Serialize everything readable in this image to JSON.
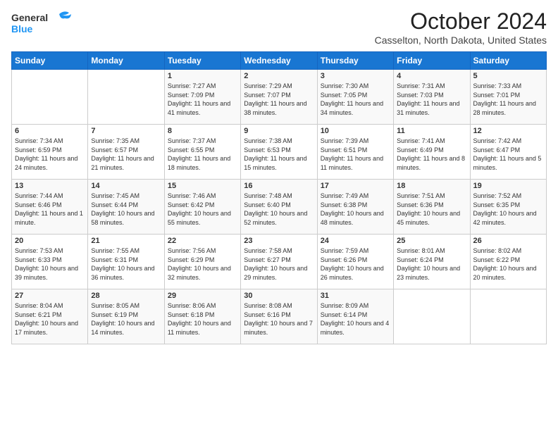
{
  "logo": {
    "line1": "General",
    "line2": "Blue"
  },
  "title": "October 2024",
  "location": "Casselton, North Dakota, United States",
  "days_of_week": [
    "Sunday",
    "Monday",
    "Tuesday",
    "Wednesday",
    "Thursday",
    "Friday",
    "Saturday"
  ],
  "weeks": [
    [
      {
        "day": "",
        "content": ""
      },
      {
        "day": "",
        "content": ""
      },
      {
        "day": "1",
        "content": "Sunrise: 7:27 AM\nSunset: 7:09 PM\nDaylight: 11 hours and 41 minutes."
      },
      {
        "day": "2",
        "content": "Sunrise: 7:29 AM\nSunset: 7:07 PM\nDaylight: 11 hours and 38 minutes."
      },
      {
        "day": "3",
        "content": "Sunrise: 7:30 AM\nSunset: 7:05 PM\nDaylight: 11 hours and 34 minutes."
      },
      {
        "day": "4",
        "content": "Sunrise: 7:31 AM\nSunset: 7:03 PM\nDaylight: 11 hours and 31 minutes."
      },
      {
        "day": "5",
        "content": "Sunrise: 7:33 AM\nSunset: 7:01 PM\nDaylight: 11 hours and 28 minutes."
      }
    ],
    [
      {
        "day": "6",
        "content": "Sunrise: 7:34 AM\nSunset: 6:59 PM\nDaylight: 11 hours and 24 minutes."
      },
      {
        "day": "7",
        "content": "Sunrise: 7:35 AM\nSunset: 6:57 PM\nDaylight: 11 hours and 21 minutes."
      },
      {
        "day": "8",
        "content": "Sunrise: 7:37 AM\nSunset: 6:55 PM\nDaylight: 11 hours and 18 minutes."
      },
      {
        "day": "9",
        "content": "Sunrise: 7:38 AM\nSunset: 6:53 PM\nDaylight: 11 hours and 15 minutes."
      },
      {
        "day": "10",
        "content": "Sunrise: 7:39 AM\nSunset: 6:51 PM\nDaylight: 11 hours and 11 minutes."
      },
      {
        "day": "11",
        "content": "Sunrise: 7:41 AM\nSunset: 6:49 PM\nDaylight: 11 hours and 8 minutes."
      },
      {
        "day": "12",
        "content": "Sunrise: 7:42 AM\nSunset: 6:47 PM\nDaylight: 11 hours and 5 minutes."
      }
    ],
    [
      {
        "day": "13",
        "content": "Sunrise: 7:44 AM\nSunset: 6:46 PM\nDaylight: 11 hours and 1 minute."
      },
      {
        "day": "14",
        "content": "Sunrise: 7:45 AM\nSunset: 6:44 PM\nDaylight: 10 hours and 58 minutes."
      },
      {
        "day": "15",
        "content": "Sunrise: 7:46 AM\nSunset: 6:42 PM\nDaylight: 10 hours and 55 minutes."
      },
      {
        "day": "16",
        "content": "Sunrise: 7:48 AM\nSunset: 6:40 PM\nDaylight: 10 hours and 52 minutes."
      },
      {
        "day": "17",
        "content": "Sunrise: 7:49 AM\nSunset: 6:38 PM\nDaylight: 10 hours and 48 minutes."
      },
      {
        "day": "18",
        "content": "Sunrise: 7:51 AM\nSunset: 6:36 PM\nDaylight: 10 hours and 45 minutes."
      },
      {
        "day": "19",
        "content": "Sunrise: 7:52 AM\nSunset: 6:35 PM\nDaylight: 10 hours and 42 minutes."
      }
    ],
    [
      {
        "day": "20",
        "content": "Sunrise: 7:53 AM\nSunset: 6:33 PM\nDaylight: 10 hours and 39 minutes."
      },
      {
        "day": "21",
        "content": "Sunrise: 7:55 AM\nSunset: 6:31 PM\nDaylight: 10 hours and 36 minutes."
      },
      {
        "day": "22",
        "content": "Sunrise: 7:56 AM\nSunset: 6:29 PM\nDaylight: 10 hours and 32 minutes."
      },
      {
        "day": "23",
        "content": "Sunrise: 7:58 AM\nSunset: 6:27 PM\nDaylight: 10 hours and 29 minutes."
      },
      {
        "day": "24",
        "content": "Sunrise: 7:59 AM\nSunset: 6:26 PM\nDaylight: 10 hours and 26 minutes."
      },
      {
        "day": "25",
        "content": "Sunrise: 8:01 AM\nSunset: 6:24 PM\nDaylight: 10 hours and 23 minutes."
      },
      {
        "day": "26",
        "content": "Sunrise: 8:02 AM\nSunset: 6:22 PM\nDaylight: 10 hours and 20 minutes."
      }
    ],
    [
      {
        "day": "27",
        "content": "Sunrise: 8:04 AM\nSunset: 6:21 PM\nDaylight: 10 hours and 17 minutes."
      },
      {
        "day": "28",
        "content": "Sunrise: 8:05 AM\nSunset: 6:19 PM\nDaylight: 10 hours and 14 minutes."
      },
      {
        "day": "29",
        "content": "Sunrise: 8:06 AM\nSunset: 6:18 PM\nDaylight: 10 hours and 11 minutes."
      },
      {
        "day": "30",
        "content": "Sunrise: 8:08 AM\nSunset: 6:16 PM\nDaylight: 10 hours and 7 minutes."
      },
      {
        "day": "31",
        "content": "Sunrise: 8:09 AM\nSunset: 6:14 PM\nDaylight: 10 hours and 4 minutes."
      },
      {
        "day": "",
        "content": ""
      },
      {
        "day": "",
        "content": ""
      }
    ]
  ]
}
